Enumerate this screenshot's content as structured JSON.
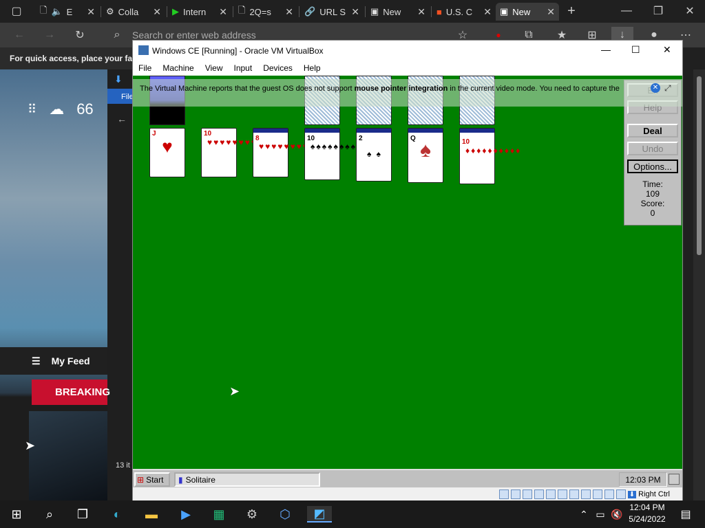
{
  "browser": {
    "tabs": [
      {
        "title": "E",
        "icon": "doc-icon"
      },
      {
        "title": "Colla",
        "icon": "collab-icon"
      },
      {
        "title": "Intern",
        "icon": "play-icon"
      },
      {
        "title": "2Q=s",
        "icon": "doc-icon"
      },
      {
        "title": "URL S",
        "icon": "url-icon"
      },
      {
        "title": "New",
        "icon": "newtab-icon"
      },
      {
        "title": "U.S. C",
        "icon": "ms-icon"
      },
      {
        "title": "New",
        "icon": "newtab-icon"
      }
    ],
    "address_placeholder": "Search or enter web address",
    "favorites_bar_text": "For quick access, place your favo",
    "colors": {
      "accent": "#0078d4"
    }
  },
  "bgpage": {
    "weather_temp": "66",
    "my_feed": "My Feed",
    "breaking": "BREAKING",
    "file_label": "File",
    "items_count": "13 it"
  },
  "vbox": {
    "title": "Windows CE [Running] - Oracle VM VirtualBox",
    "menu": [
      "File",
      "Machine",
      "View",
      "Input",
      "Devices",
      "Help"
    ],
    "notice_prefix": "The Virtual Machine reports that the guest OS does not support ",
    "notice_bold": "mouse pointer integration",
    "notice_suffix": " in the current video mode. You need to capture the",
    "host_key": "Right Ctrl"
  },
  "solitaire": {
    "buttons": {
      "exit": "Ex",
      "help": "Help",
      "deal": "Deal",
      "undo": "Undo",
      "options": "Options..."
    },
    "time_label": "Time:",
    "time_value": "109",
    "score_label": "Score:",
    "score_value": "0",
    "cards": [
      {
        "rank": "J",
        "suit": "♥",
        "pip": "♥"
      },
      {
        "rank": "10",
        "suit": "♥",
        "pip": "♥♥♥♥♥♥♥♥♥♥"
      },
      {
        "rank": "8",
        "suit": "♥",
        "pip": "♥♥♥♥♥♥♥♥"
      },
      {
        "rank": "10",
        "suit": "♠",
        "pip": "♠♠♠♠♠♠♠♠♠♠"
      },
      {
        "rank": "2",
        "suit": "♠",
        "pip": "♠ ♠"
      },
      {
        "rank": "Q",
        "suit": "♠",
        "pip": "♠"
      },
      {
        "rank": "10",
        "suit": "♦",
        "pip": "♦♦♦♦♦♦♦♦♦♦"
      }
    ]
  },
  "ce_taskbar": {
    "start": "Start",
    "app": "Solitaire",
    "clock": "12:03 PM"
  },
  "win_taskbar": {
    "time": "12:04 PM",
    "date": "5/24/2022"
  }
}
